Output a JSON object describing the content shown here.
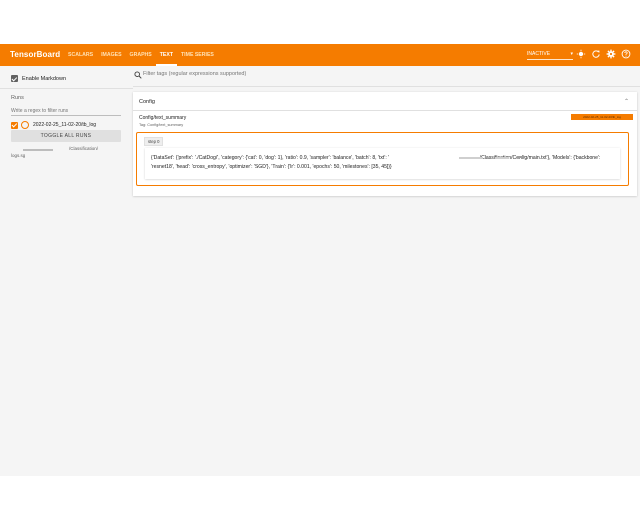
{
  "app": {
    "brand": "TensorBoard",
    "tabs": [
      {
        "label": "Scalars",
        "active": false
      },
      {
        "label": "Images",
        "active": false
      },
      {
        "label": "Graphs",
        "active": false
      },
      {
        "label": "Text",
        "active": true
      },
      {
        "label": "Time Series",
        "active": false
      }
    ],
    "status_select": "INACTIVE",
    "icons": [
      "settings-brightness-icon",
      "refresh-icon",
      "gear-icon",
      "help-icon"
    ],
    "accent_color": "#f57c00"
  },
  "sidebar": {
    "enable_markdown_label": "Enable Markdown",
    "runs_title": "Runs",
    "runs_filter_placeholder": "Write a regex to filter runs",
    "run_name": "2022-02-25_11-02-20/tb_log",
    "toggle_all_label": "TOGGLE ALL RUNS",
    "path_text": "/Classification/",
    "path_sub": "logs.sg"
  },
  "main": {
    "search_placeholder": "Filter tags (regular expressions supported)",
    "card": {
      "title": "Config",
      "summary_name": "Config/text_summary",
      "summary_tag": "Tag: Config/text_summary",
      "run_chip": "2022-02-25_11-02-20/tb_log",
      "step_label": "step 0",
      "content": "{'DataSet': {'prefix': './CatDog/', 'category': {'cat': 0, 'dog': 1}, 'ratio': 0.9, 'sampler': 'balance', 'batch': 8, 'txt': '                                                                /Classification/Config/main.txt'}, 'Models': {'backbone': 'resnet18', 'head': 'cross_entropy', 'optimizer': 'SGD'}, 'Train': {'lr': 0.001, 'epochs': 50, 'milestones': [35, 45]}}"
    }
  }
}
